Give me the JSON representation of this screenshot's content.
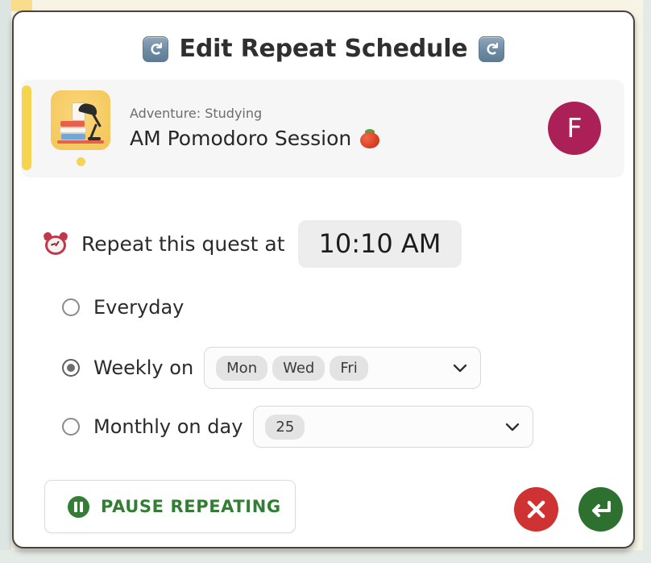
{
  "header": {
    "title": "Edit Repeat Schedule",
    "left_icon": "repeat-icon",
    "right_icon": "repeat-icon"
  },
  "quest_card": {
    "accent_color": "#F6D44F",
    "thumbnail_icon": "desk-lamp-books-icon",
    "adventure_label": "Adventure: Studying",
    "quest_title": "AM Pomodoro Session",
    "quest_title_emoji": "tomato-icon",
    "avatar_initial": "F",
    "avatar_color": "#AB2057"
  },
  "schedule": {
    "time_icon": "alarm-clock-icon",
    "time_label": "Repeat this quest at",
    "time_value": "10:10 AM",
    "options": [
      {
        "id": "everyday",
        "label": "Everyday",
        "selected": false,
        "has_select": false
      },
      {
        "id": "weekly",
        "label": "Weekly on",
        "selected": true,
        "has_select": true,
        "chips": [
          "Mon",
          "Wed",
          "Fri"
        ]
      },
      {
        "id": "monthly",
        "label": "Monthly on day",
        "selected": false,
        "has_select": true,
        "chips": [
          "25"
        ]
      }
    ]
  },
  "footer": {
    "pause_label": "PAUSE REPEATING",
    "pause_icon": "pause-circle-icon",
    "pause_color": "#337E34",
    "cancel_icon": "close-icon",
    "cancel_color": "#CE3232",
    "confirm_icon": "enter-return-icon",
    "confirm_color": "#2D7030"
  }
}
